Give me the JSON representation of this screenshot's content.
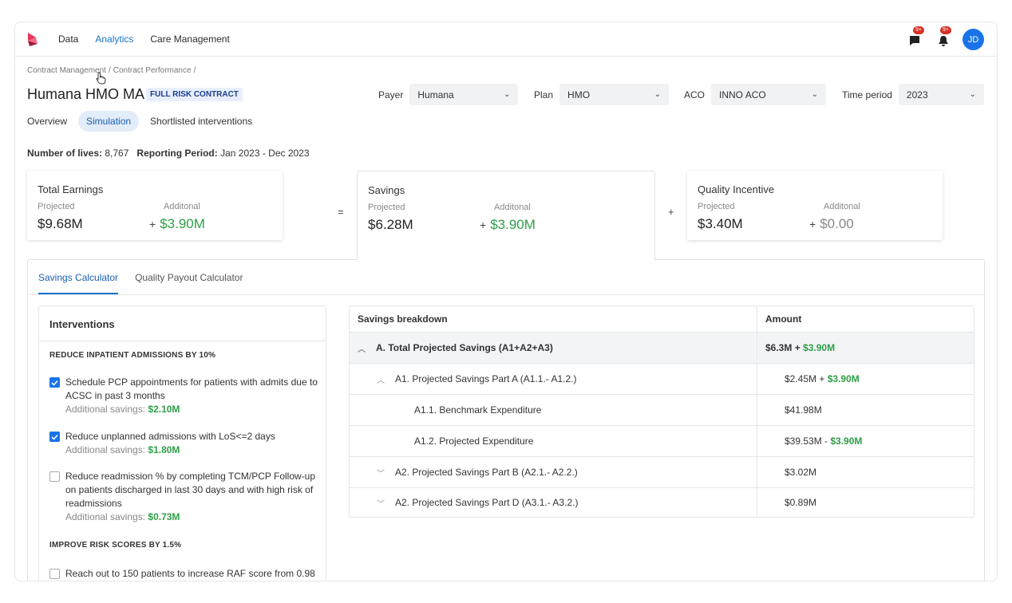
{
  "nav": {
    "items": [
      "Data",
      "Analytics",
      "Care Management"
    ],
    "active": "Analytics",
    "notifications": [
      {
        "icon": "chat-icon",
        "badge": "9+"
      },
      {
        "icon": "bell-icon",
        "badge": "9+"
      }
    ],
    "avatar": "JD"
  },
  "breadcrumb": [
    "Contract Management",
    "Contract Performance"
  ],
  "page": {
    "title": "Humana HMO MA",
    "badge": "FULL RISK CONTRACT",
    "tabs": [
      "Overview",
      "Simulation",
      "Shortlisted interventions"
    ],
    "active_tab": "Simulation",
    "lives_label": "Number of lives:",
    "lives_value": "8,767",
    "period_label": "Reporting Period:",
    "period_value": "Jan 2023 - Dec 2023"
  },
  "filters": {
    "payer": {
      "label": "Payer",
      "value": "Humana"
    },
    "plan": {
      "label": "Plan",
      "value": "HMO"
    },
    "aco": {
      "label": "ACO",
      "value": "INNO ACO"
    },
    "time": {
      "label": "Time period",
      "value": "2023"
    }
  },
  "cards": {
    "total": {
      "title": "Total Earnings",
      "proj_label": "Projected",
      "add_label": "Additonal",
      "projected": "$9.68M",
      "additional": "$3.90M"
    },
    "savings": {
      "title": "Savings",
      "proj_label": "Projected",
      "add_label": "Additonal",
      "projected": "$6.28M",
      "additional": "$3.90M"
    },
    "quality": {
      "title": "Quality Incentive",
      "proj_label": "Projected",
      "add_label": "Additonal",
      "projected": "$3.40M",
      "additional": "$0.00"
    },
    "op_equals": "=",
    "op_plus": "+",
    "add_plus": "+"
  },
  "calc_tabs": [
    "Savings Calculator",
    "Quality Payout Calculator"
  ],
  "interventions": {
    "title": "Interventions",
    "save_label": "Additional savings:",
    "sections": [
      {
        "heading": "REDUCE INPATIENT ADMISSIONS BY 10%"
      },
      {
        "heading": "IMPROVE RISK SCORES BY 1.5%"
      }
    ],
    "items": [
      {
        "text": "Schedule PCP appointments for patients with admits due to ACSC in past 3 months",
        "savings": "$2.10M",
        "checked": true
      },
      {
        "text": "Reduce unplanned admissions with LoS<=2 days",
        "savings": "$1.80M",
        "checked": true
      },
      {
        "text": "Reduce readmission % by completing TCM/PCP Follow-up on patients discharged in last 30 days and with high risk of readmissions",
        "savings": "$0.73M",
        "checked": false
      },
      {
        "text": "Reach out to 150 patients to increase RAF score from 0.98",
        "checked": false
      }
    ]
  },
  "breakdown": {
    "headers": [
      "Savings breakdown",
      "Amount"
    ],
    "rows": [
      {
        "label": "A. Total Projected Savings (A1+A2+A3)",
        "amount": "$6.3M",
        "op": " + ",
        "delta": "$3.90M"
      },
      {
        "label": "A1. Projected Savings Part A (A1.1.- A1.2.)",
        "amount": "$2.45M",
        "op": " + ",
        "delta": "$3.90M"
      },
      {
        "label": "A1.1. Benchmark Expenditure",
        "amount": "$41.98M"
      },
      {
        "label": "A1.2. Projected Expenditure",
        "amount": "$39.53M",
        "op": " - ",
        "delta": "$3.90M"
      },
      {
        "label": "A2. Projected Savings Part B (A2.1.- A2.2.)",
        "amount": "$3.02M"
      },
      {
        "label": "A2. Projected Savings Part D (A3.1.- A3.2.)",
        "amount": "$0.89M"
      }
    ]
  },
  "colors": {
    "accent": "#1a73c9",
    "green": "#2e9e48",
    "badge_red": "#d93025"
  }
}
